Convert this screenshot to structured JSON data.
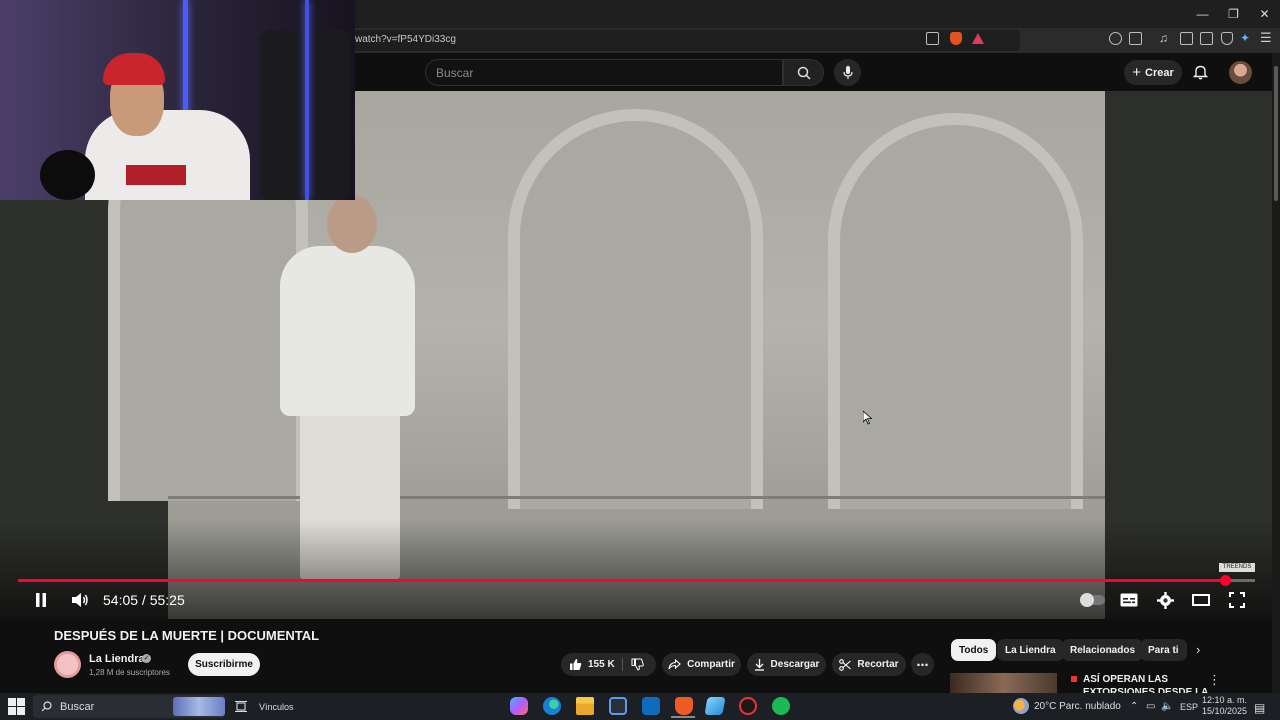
{
  "browser": {
    "url": "watch?v=fP54YDi33cg",
    "window_controls": [
      "—",
      "❐",
      "✕"
    ]
  },
  "yt_header": {
    "search_placeholder": "Buscar",
    "create_label": "Crear"
  },
  "player": {
    "time_display": "54:05 / 55:25",
    "progress_fraction": 0.976,
    "watermark": "TREENDS"
  },
  "video_info": {
    "title": "DESPUÉS DE LA MUERTE | DOCUMENTAL",
    "channel_name": "La Liendra",
    "subscribers": "1,28 M de suscriptores",
    "subscribe_label": "Suscribirme",
    "likes": "155 K",
    "share_label": "Compartir",
    "download_label": "Descargar",
    "clip_label": "Recortar"
  },
  "chips": [
    "Todos",
    "La Liendra",
    "Relacionados",
    "Para ti"
  ],
  "recommended": {
    "title_line1": "ASÍ OPERAN LAS",
    "title_line2": "EXTORSIONES DESDE LA"
  },
  "taskbar": {
    "search_label": "Buscar",
    "links_label": "Vínculos",
    "weather": "20°C  Parc. nublado",
    "language": "ESP",
    "time": "12:10 a. m.",
    "date": "15/10/2025"
  },
  "colors": {
    "accent_red": "#ff0033",
    "background": "#0f0f0f"
  }
}
